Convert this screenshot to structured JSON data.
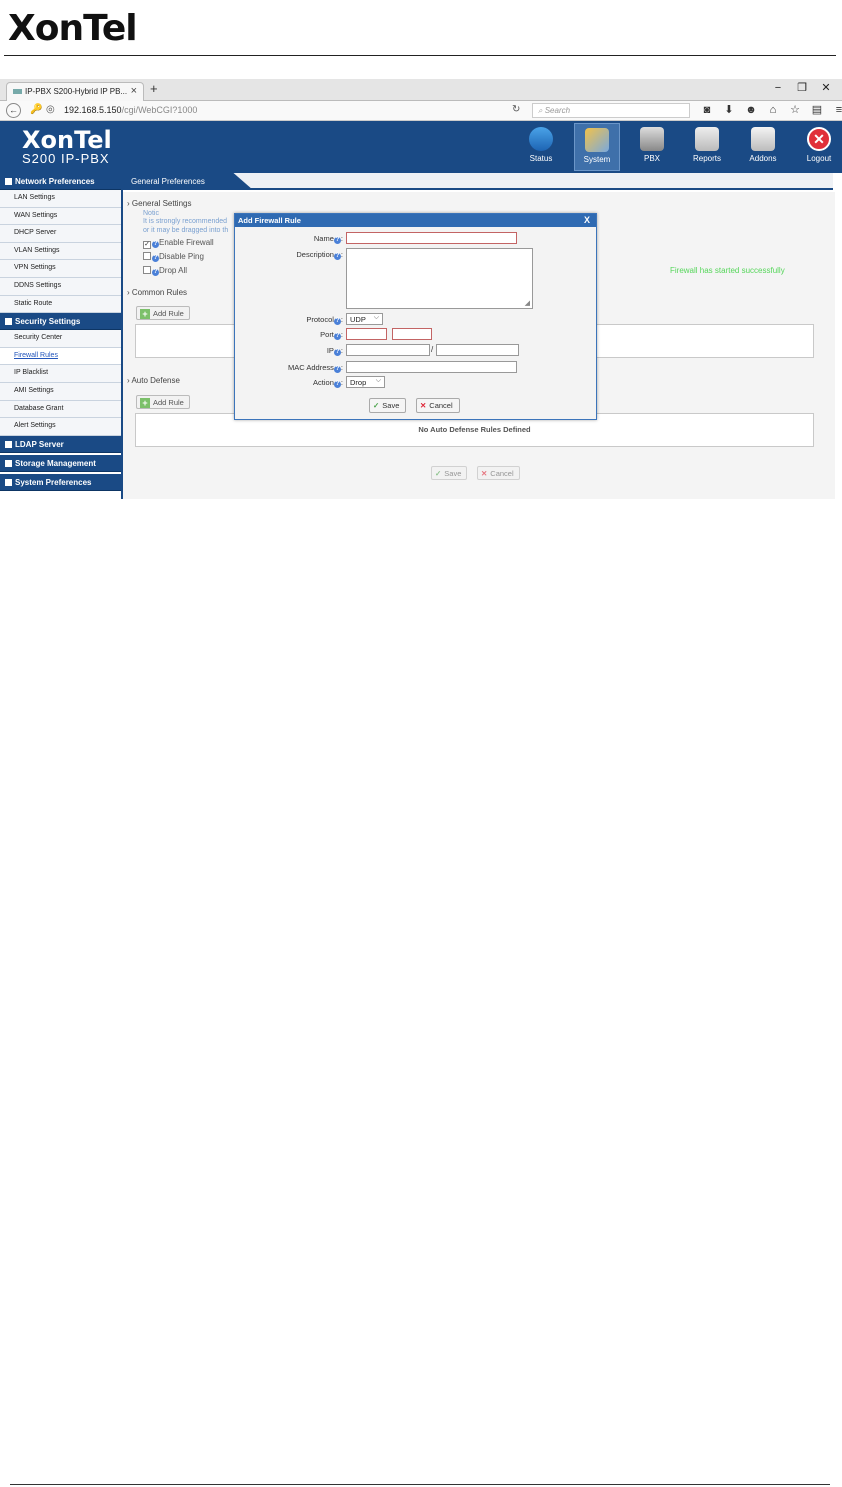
{
  "document": {
    "logo": "XonTel"
  },
  "browser": {
    "tab_title": "IP-PBX S200-Hybrid IP PB...",
    "tab_close": "×",
    "new_tab": "+",
    "win_min": "−",
    "win_max": "❐",
    "win_close": "✕",
    "url_host": "192.168.5.150",
    "url_path": "/cgi/WebCGI?1000",
    "search_placeholder": "Search",
    "toolbar_icons": [
      "pocket-icon",
      "download-icon",
      "smiley-icon",
      "home-icon",
      "bookmark-star-icon",
      "reading-list-icon",
      "menu-icon"
    ]
  },
  "app": {
    "brand_name": "XonTel",
    "brand_product": "S200 IP-PBX",
    "modules": [
      {
        "label": "Status",
        "icon": "status-icon"
      },
      {
        "label": "System",
        "icon": "system-icon",
        "active": true
      },
      {
        "label": "PBX",
        "icon": "pbx-icon"
      },
      {
        "label": "Reports",
        "icon": "reports-icon"
      },
      {
        "label": "Addons",
        "icon": "addons-icon"
      },
      {
        "label": "Logout",
        "icon": "logout-icon"
      }
    ]
  },
  "sidebar": {
    "network": {
      "title": "Network Preferences",
      "items": [
        "LAN Settings",
        "WAN Settings",
        "DHCP Server",
        "VLAN Settings",
        "VPN Settings",
        "DDNS Settings",
        "Static Route"
      ]
    },
    "security": {
      "title": "Security Settings",
      "items": [
        "Security Center",
        "Firewall Rules",
        "IP Blacklist",
        "AMI Settings",
        "Database Grant",
        "Alert Settings"
      ],
      "active_item": "Firewall Rules"
    },
    "ldap": {
      "title": "LDAP Server"
    },
    "storage": {
      "title": "Storage Management"
    },
    "system": {
      "title": "System Preferences"
    }
  },
  "content": {
    "tab": "General Preferences",
    "general_settings": "General Settings",
    "notice_1": "Notic",
    "notice_2": "It is strongly recommended",
    "notice_3": "or it may be dragged into th",
    "enable_firewall": "Enable Firewall",
    "disable_ping": "Disable Ping",
    "drop_all": "Drop All",
    "firewall_status": "Firewall has started successfully",
    "common_rules": "Common Rules",
    "add_rule": "Add Rule",
    "auto_defense": "Auto Defense",
    "add_rule_2": "Add Rule",
    "no_auto_defense": "No Auto Defense Rules Defined",
    "save": "Save",
    "cancel": "Cancel"
  },
  "dialog": {
    "title": "Add Firewall Rule",
    "close": "X",
    "name_label": "Name",
    "description_label": "Description",
    "protocol_label": "Protocol",
    "protocol_value": "UDP",
    "port_label": "Port",
    "ip_label": "IP",
    "ip_separator": "/",
    "mac_label": "MAC Address",
    "action_label": "Action",
    "action_value": "Drop",
    "save": "Save",
    "cancel": "Cancel"
  }
}
